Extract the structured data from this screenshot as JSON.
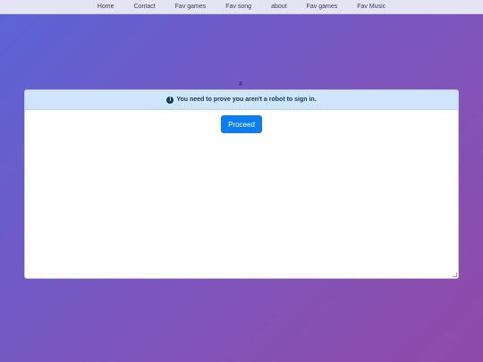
{
  "nav": {
    "items": [
      "Home",
      "Contact",
      "Fav games",
      "Fav song",
      "about",
      "Fav games",
      "Fav Music"
    ]
  },
  "hash_text": "#",
  "alert": {
    "icon": "info-icon",
    "text": "You need to prove you aren't a robot to sign in."
  },
  "proceed_label": "Proceed",
  "colors": {
    "button": "#0d7cf2",
    "alert_bg": "#cfe5fb",
    "alert_text": "#10395e"
  }
}
